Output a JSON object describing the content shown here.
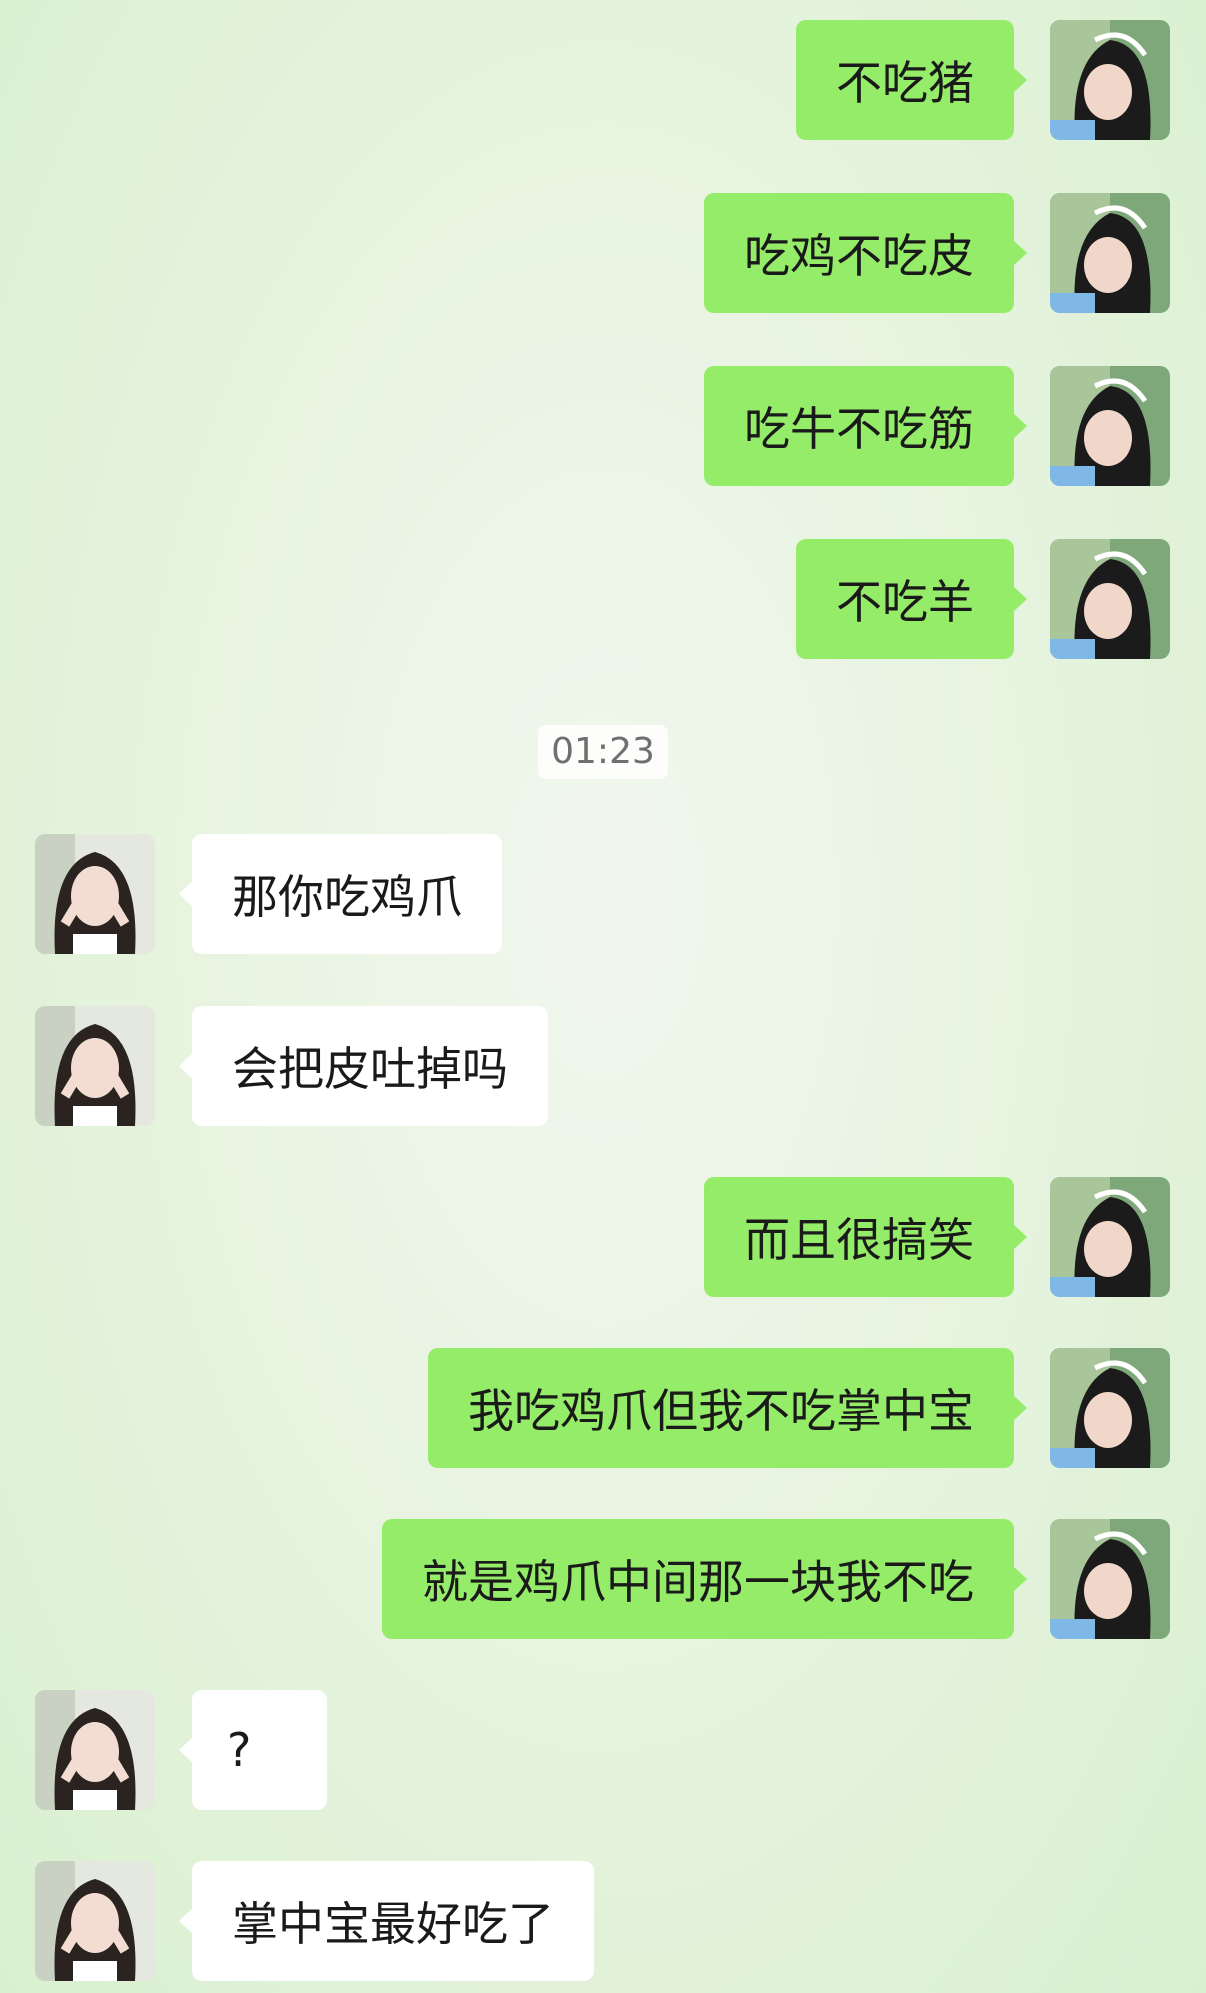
{
  "timestamp": "01:23",
  "messages": [
    {
      "from": "me",
      "text": "不吃猪"
    },
    {
      "from": "me",
      "text": "吃鸡不吃皮"
    },
    {
      "from": "me",
      "text": "吃牛不吃筋"
    },
    {
      "from": "me",
      "text": "不吃羊"
    },
    {
      "from": "them",
      "text": "那你吃鸡爪"
    },
    {
      "from": "them",
      "text": "会把皮吐掉吗"
    },
    {
      "from": "me",
      "text": "而且很搞笑"
    },
    {
      "from": "me",
      "text": "我吃鸡爪但我不吃掌中宝"
    },
    {
      "from": "me",
      "text": "就是鸡爪中间那一块我不吃"
    },
    {
      "from": "them",
      "text": "?"
    },
    {
      "from": "them",
      "text": "掌中宝最好吃了"
    }
  ],
  "colors": {
    "my_bubble": "#95ec69",
    "their_bubble": "#ffffff",
    "timestamp_text": "#6f6f6f"
  }
}
